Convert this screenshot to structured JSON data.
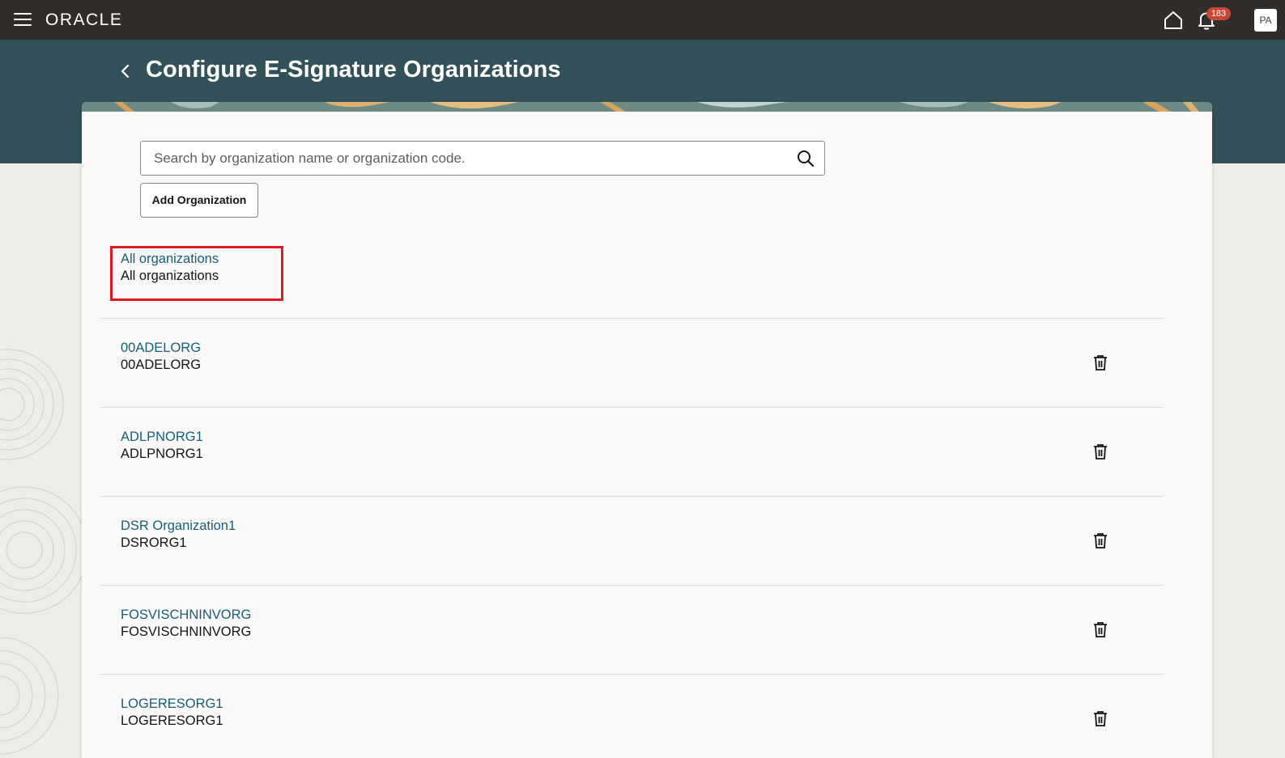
{
  "header": {
    "brand": "ORACLE",
    "notification_count": "183",
    "user_initials": "PA"
  },
  "page": {
    "title": "Configure E-Signature Organizations"
  },
  "search": {
    "placeholder": "Search by organization name or organization code."
  },
  "actions": {
    "add_label": "Add Organization"
  },
  "all_orgs": {
    "name": "All organizations",
    "code": "All organizations"
  },
  "organizations": [
    {
      "name": "00ADELORG",
      "code": "00ADELORG"
    },
    {
      "name": "ADLPNORG1",
      "code": "ADLPNORG1"
    },
    {
      "name": "DSR Organization1",
      "code": "DSRORG1"
    },
    {
      "name": "FOSVISCHNINVORG",
      "code": "FOSVISCHNINVORG"
    },
    {
      "name": "LOGERESORG1",
      "code": "LOGERESORG1"
    }
  ],
  "colors": {
    "header_bg": "#312d2a",
    "banner_bg": "#325158",
    "link": "#145f7a",
    "highlight": "#e11b22",
    "badge": "#c74634"
  }
}
